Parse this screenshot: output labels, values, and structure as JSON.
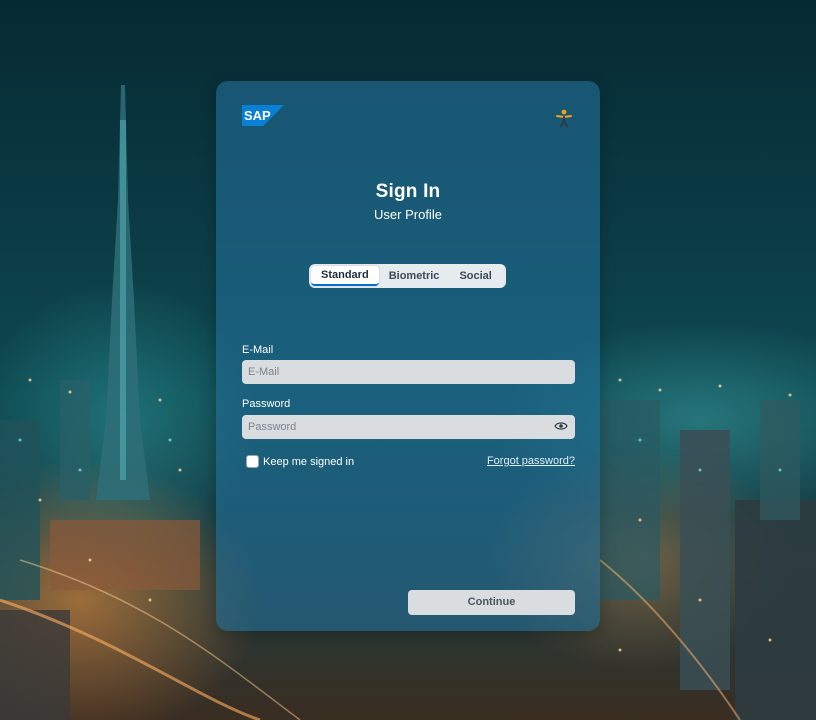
{
  "brand": {
    "logo_text": "SAP",
    "logo_color": "#0a7fd6"
  },
  "header": {
    "title": "Sign In",
    "subtitle": "User Profile"
  },
  "tabs": [
    {
      "label": "Standard",
      "active": true
    },
    {
      "label": "Biometric",
      "active": false
    },
    {
      "label": "Social",
      "active": false
    }
  ],
  "form": {
    "email": {
      "label": "E-Mail",
      "placeholder": "E-Mail",
      "value": ""
    },
    "password": {
      "label": "Password",
      "placeholder": "Password",
      "value": ""
    },
    "keep_signed_in": {
      "label": "Keep me signed in",
      "checked": false
    },
    "forgot_password": "Forgot password?",
    "continue_label": "Continue"
  },
  "icons": {
    "accessibility": "accessibility-icon",
    "show_password": "eye-icon"
  }
}
